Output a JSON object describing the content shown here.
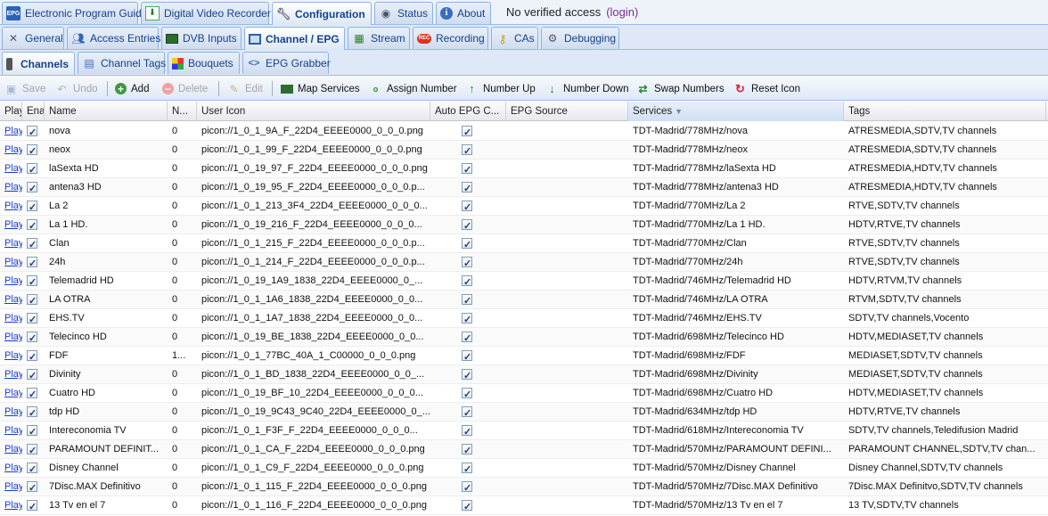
{
  "tabs_l1": [
    {
      "label": "Electronic Program Guide",
      "icon": "epg-icon"
    },
    {
      "label": "Digital Video Recorder",
      "icon": "dvr-icon"
    },
    {
      "label": "Configuration",
      "icon": "wrench-icon",
      "active": true
    },
    {
      "label": "Status",
      "icon": "eye-icon"
    },
    {
      "label": "About",
      "icon": "info-icon"
    }
  ],
  "access": {
    "text": "No verified access",
    "login": "(login)"
  },
  "tabs_l2": [
    {
      "label": "General",
      "icon": "tools-icon"
    },
    {
      "label": "Access Entries",
      "icon": "users-icon"
    },
    {
      "label": "DVB Inputs",
      "icon": "card-icon"
    },
    {
      "label": "Channel / EPG",
      "icon": "tv-icon",
      "active": true
    },
    {
      "label": "Stream",
      "icon": "stream-icon"
    },
    {
      "label": "Recording",
      "icon": "rec-icon"
    },
    {
      "label": "CAs",
      "icon": "key-icon"
    },
    {
      "label": "Debugging",
      "icon": "gears-icon"
    }
  ],
  "tabs_l3": [
    {
      "label": "Channels",
      "icon": "remote-icon",
      "active": true
    },
    {
      "label": "Channel Tags",
      "icon": "tag-icon"
    },
    {
      "label": "Bouquets",
      "icon": "grid-icon"
    },
    {
      "label": "EPG Grabber",
      "icon": "code-icon"
    }
  ],
  "toolbar": {
    "save": "Save",
    "undo": "Undo",
    "add": "Add",
    "delete": "Delete",
    "edit": "Edit",
    "map_services": "Map Services",
    "assign_number": "Assign Number",
    "number_up": "Number Up",
    "number_down": "Number Down",
    "swap_numbers": "Swap Numbers",
    "reset_icon": "Reset Icon"
  },
  "columns": {
    "play": "Play",
    "enabled": "Ena",
    "name": "Name",
    "number": "N...",
    "user_icon": "User Icon",
    "auto_epg": "Auto EPG C...",
    "epg_source": "EPG Source",
    "services": "Services",
    "tags": "Tags"
  },
  "colors": {
    "link": "#1a3bcc",
    "tab_text": "#15428b",
    "login": "#7b2c8e"
  },
  "play_text": "Play",
  "rows": [
    {
      "name": "nova",
      "num": "0",
      "icon": "picon://1_0_1_9A_F_22D4_EEEE0000_0_0_0.png",
      "service": "TDT-Madrid/778MHz/nova",
      "tags": "ATRESMEDIA,SDTV,TV channels"
    },
    {
      "name": "neox",
      "num": "0",
      "icon": "picon://1_0_1_99_F_22D4_EEEE0000_0_0_0.png",
      "service": "TDT-Madrid/778MHz/neox",
      "tags": "ATRESMEDIA,SDTV,TV channels"
    },
    {
      "name": "laSexta HD",
      "num": "0",
      "icon": "picon://1_0_19_97_F_22D4_EEEE0000_0_0_0.png",
      "service": "TDT-Madrid/778MHz/laSexta HD",
      "tags": "ATRESMEDIA,HDTV,TV channels"
    },
    {
      "name": "antena3 HD",
      "num": "0",
      "icon": "picon://1_0_19_95_F_22D4_EEEE0000_0_0_0.p...",
      "service": "TDT-Madrid/778MHz/antena3 HD",
      "tags": "ATRESMEDIA,HDTV,TV channels"
    },
    {
      "name": "La 2",
      "num": "0",
      "icon": "picon://1_0_1_213_3F4_22D4_EEEE0000_0_0_0...",
      "service": "TDT-Madrid/770MHz/La 2",
      "tags": "RTVE,SDTV,TV channels"
    },
    {
      "name": "La 1 HD.",
      "num": "0",
      "icon": "picon://1_0_19_216_F_22D4_EEEE0000_0_0_0...",
      "service": "TDT-Madrid/770MHz/La 1 HD.",
      "tags": "HDTV,RTVE,TV channels"
    },
    {
      "name": "Clan",
      "num": "0",
      "icon": "picon://1_0_1_215_F_22D4_EEEE0000_0_0_0.p...",
      "service": "TDT-Madrid/770MHz/Clan",
      "tags": "RTVE,SDTV,TV channels"
    },
    {
      "name": "24h",
      "num": "0",
      "icon": "picon://1_0_1_214_F_22D4_EEEE0000_0_0_0.p...",
      "service": "TDT-Madrid/770MHz/24h",
      "tags": "RTVE,SDTV,TV channels"
    },
    {
      "name": "Telemadrid HD",
      "num": "0",
      "icon": "picon://1_0_19_1A9_1838_22D4_EEEE0000_0_...",
      "service": "TDT-Madrid/746MHz/Telemadrid HD",
      "tags": "HDTV,RTVM,TV channels"
    },
    {
      "name": "LA OTRA",
      "num": "0",
      "icon": "picon://1_0_1_1A6_1838_22D4_EEEE0000_0_0...",
      "service": "TDT-Madrid/746MHz/LA OTRA",
      "tags": "RTVM,SDTV,TV channels"
    },
    {
      "name": "EHS.TV",
      "num": "0",
      "icon": "picon://1_0_1_1A7_1838_22D4_EEEE0000_0_0...",
      "service": "TDT-Madrid/746MHz/EHS.TV",
      "tags": "SDTV,TV channels,Vocento"
    },
    {
      "name": "Telecinco HD",
      "num": "0",
      "icon": "picon://1_0_19_BE_1838_22D4_EEEE0000_0_0...",
      "service": "TDT-Madrid/698MHz/Telecinco HD",
      "tags": "HDTV,MEDIASET,TV channels"
    },
    {
      "name": "FDF",
      "num": "1...",
      "icon": "picon://1_0_1_77BC_40A_1_C00000_0_0_0.png",
      "service": "TDT-Madrid/698MHz/FDF",
      "tags": "MEDIASET,SDTV,TV channels"
    },
    {
      "name": "Divinity",
      "num": "0",
      "icon": "picon://1_0_1_BD_1838_22D4_EEEE0000_0_0_...",
      "service": "TDT-Madrid/698MHz/Divinity",
      "tags": "MEDIASET,SDTV,TV channels"
    },
    {
      "name": "Cuatro HD",
      "num": "0",
      "icon": "picon://1_0_19_BF_10_22D4_EEEE0000_0_0_0...",
      "service": "TDT-Madrid/698MHz/Cuatro HD",
      "tags": "HDTV,MEDIASET,TV channels"
    },
    {
      "name": "tdp HD",
      "num": "0",
      "icon": "picon://1_0_19_9C43_9C40_22D4_EEEE0000_0_...",
      "service": "TDT-Madrid/634MHz/tdp HD",
      "tags": "HDTV,RTVE,TV channels"
    },
    {
      "name": "Intereconomia TV",
      "num": "0",
      "icon": "picon://1_0_1_F3F_F_22D4_EEEE0000_0_0_0...",
      "service": "TDT-Madrid/618MHz/Intereconomia TV",
      "tags": "SDTV,TV channels,Teledifusion Madrid"
    },
    {
      "name": "PARAMOUNT DEFINIT...",
      "num": "0",
      "icon": "picon://1_0_1_CA_F_22D4_EEEE0000_0_0_0.png",
      "service": "TDT-Madrid/570MHz/PARAMOUNT DEFINI...",
      "tags": "PARAMOUNT CHANNEL,SDTV,TV chan..."
    },
    {
      "name": "Disney Channel",
      "num": "0",
      "icon": "picon://1_0_1_C9_F_22D4_EEEE0000_0_0_0.png",
      "service": "TDT-Madrid/570MHz/Disney Channel",
      "tags": "Disney Channel,SDTV,TV channels"
    },
    {
      "name": "7Disc.MAX Definitivo",
      "num": "0",
      "icon": "picon://1_0_1_115_F_22D4_EEEE0000_0_0_0.png",
      "service": "TDT-Madrid/570MHz/7Disc.MAX Definitivo",
      "tags": "7Disc.MAX Definitvo,SDTV,TV channels"
    },
    {
      "name": "13 Tv en el 7",
      "num": "0",
      "icon": "picon://1_0_1_116_F_22D4_EEEE0000_0_0_0.png",
      "service": "TDT-Madrid/570MHz/13 Tv en el 7",
      "tags": "13 TV,SDTV,TV channels"
    }
  ]
}
